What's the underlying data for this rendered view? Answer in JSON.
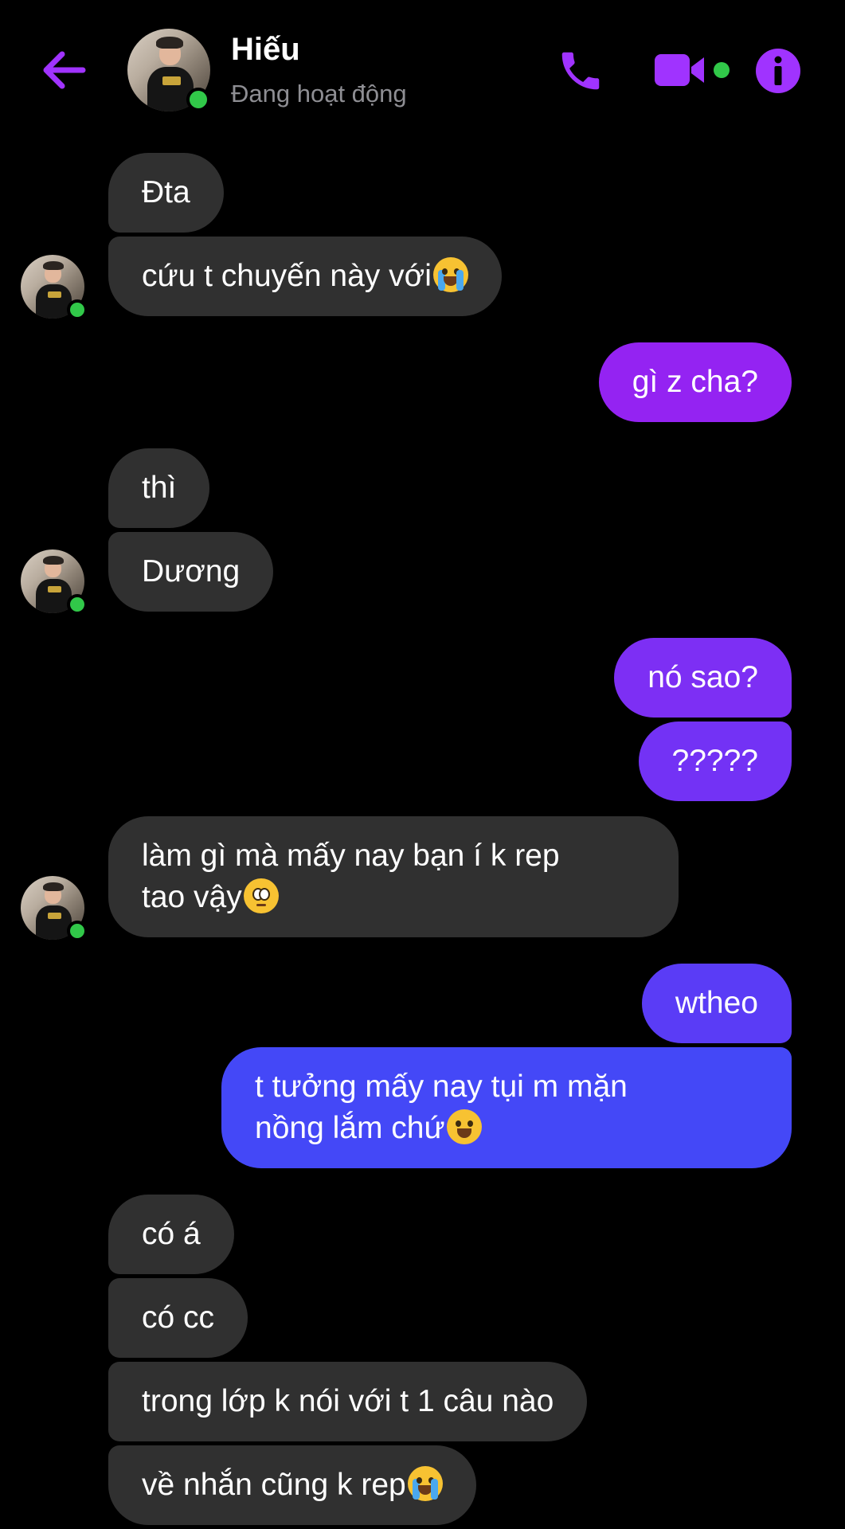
{
  "header": {
    "contact_name": "Hiếu",
    "status": "Đang hoạt động",
    "accent_color": "#a033ff",
    "online_color": "#31c849",
    "icons": [
      "back-arrow-icon",
      "phone-icon",
      "video-camera-icon",
      "info-icon"
    ]
  },
  "messages": [
    {
      "from": "contact",
      "text": "Đta"
    },
    {
      "from": "contact",
      "text": "cứu t chuyến này với",
      "emoji": "😭"
    },
    {
      "from": "me",
      "text": "gì z cha?"
    },
    {
      "from": "contact",
      "text": "thì"
    },
    {
      "from": "contact",
      "text": "Dương"
    },
    {
      "from": "me",
      "text": "nó sao?"
    },
    {
      "from": "me",
      "text": "?????"
    },
    {
      "from": "contact",
      "text_line1": "làm gì mà mấy nay bạn í k rep",
      "text_line2": "tao vậy",
      "emoji": "🥺"
    },
    {
      "from": "me",
      "text": "wtheo"
    },
    {
      "from": "me",
      "text_line1": "t tưởng mấy nay tụi m mặn",
      "text_line2": "nồng lắm chứ",
      "emoji": "😛"
    },
    {
      "from": "contact",
      "text": "có á"
    },
    {
      "from": "contact",
      "text": "có cc"
    },
    {
      "from": "contact",
      "text": "trong lớp k nói với t 1 câu nào"
    },
    {
      "from": "contact",
      "text": "về nhắn cũng k rep",
      "emoji": "😭"
    }
  ],
  "colors": {
    "incoming_bubble": "#303030",
    "outgoing_gradient_top": "#a21cf0",
    "outgoing_gradient_bottom": "#3d57f7"
  }
}
